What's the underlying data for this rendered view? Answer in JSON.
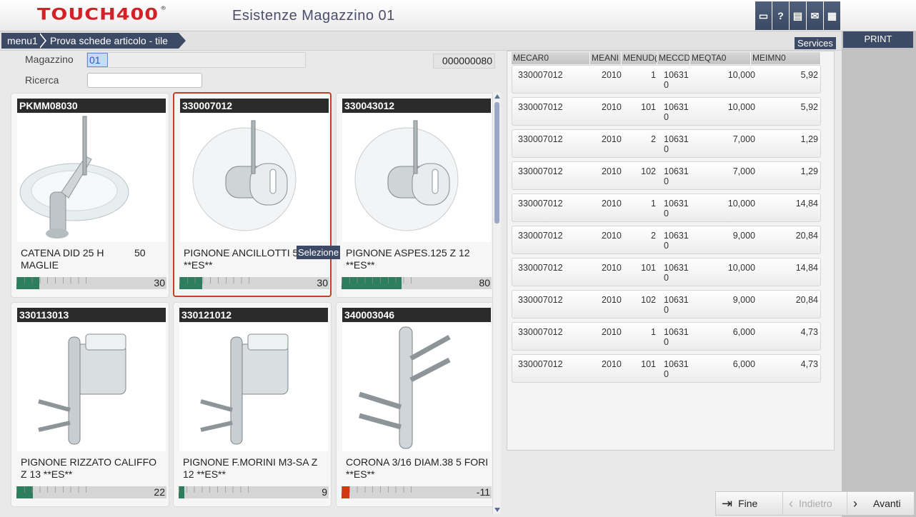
{
  "header": {
    "logo": "TOUCH400",
    "logo_mark": "®",
    "title": "Esistenze Magazzino 01",
    "icons": [
      {
        "name": "monitor-icon",
        "glyph": "▭"
      },
      {
        "name": "help-icon",
        "glyph": "?"
      },
      {
        "name": "document-icon",
        "glyph": "▤"
      },
      {
        "name": "mail-icon",
        "glyph": "✉"
      },
      {
        "name": "grid-icon",
        "glyph": "▦"
      }
    ]
  },
  "breadcrumb": {
    "items": [
      "menu1",
      "Prova schede articolo - tile"
    ]
  },
  "services_label": "Services",
  "print_label": "PRINT",
  "form": {
    "magazzino_label": "Magazzino",
    "magazzino_value": "01",
    "ricerca_label": "Ricerca",
    "ricerca_value": "",
    "counter": "000000080"
  },
  "tooltip": "Selezione",
  "tiles": [
    {
      "code": "PKMM08030",
      "desc": "CATENA DID 25 H MAGLIE",
      "extra": "50",
      "qty": "30",
      "level": 0.15,
      "negative": false
    },
    {
      "code": "330007012",
      "desc": "PIGNONE ANCILLOTTI 50 **ES**",
      "extra": "",
      "qty": "30",
      "level": 0.15,
      "negative": false
    },
    {
      "code": "330043012",
      "desc": "PIGNONE ASPES.125 Z 12 **ES**",
      "extra": "",
      "qty": "80",
      "level": 0.4,
      "negative": false
    },
    {
      "code": "330113013",
      "desc": "PIGNONE RIZZATO CALIFFO Z 13 **ES**",
      "extra": "",
      "qty": "22",
      "level": 0.11,
      "negative": false
    },
    {
      "code": "330121012",
      "desc": "PIGNONE F.MORINI M3-SA Z 12 **ES**",
      "extra": "",
      "qty": "9",
      "level": 0.04,
      "negative": false
    },
    {
      "code": "340003046",
      "desc": "CORONA 3/16 DIAM.38 5 FORI **ES**",
      "extra": "",
      "qty": "-11",
      "level": 0.05,
      "negative": true
    }
  ],
  "grid": {
    "columns": [
      "MECAR0",
      "MEANI",
      "MENUD(",
      "MECCD",
      "MEQTA0",
      "MEIMN0"
    ],
    "rows": [
      {
        "mecar": "330007012",
        "meani": "2010",
        "menud": "1",
        "meccd": "10631\n0",
        "meqta": "10,000",
        "meimn": "5,92"
      },
      {
        "mecar": "330007012",
        "meani": "2010",
        "menud": "101",
        "meccd": "10631\n0",
        "meqta": "10,000",
        "meimn": "5,92"
      },
      {
        "mecar": "330007012",
        "meani": "2010",
        "menud": "2",
        "meccd": "10631\n0",
        "meqta": "7,000",
        "meimn": "1,29"
      },
      {
        "mecar": "330007012",
        "meani": "2010",
        "menud": "102",
        "meccd": "10631\n0",
        "meqta": "7,000",
        "meimn": "1,29"
      },
      {
        "mecar": "330007012",
        "meani": "2010",
        "menud": "1",
        "meccd": "10631\n0",
        "meqta": "10,000",
        "meimn": "14,84"
      },
      {
        "mecar": "330007012",
        "meani": "2010",
        "menud": "2",
        "meccd": "10631\n0",
        "meqta": "9,000",
        "meimn": "20,84"
      },
      {
        "mecar": "330007012",
        "meani": "2010",
        "menud": "101",
        "meccd": "10631\n0",
        "meqta": "10,000",
        "meimn": "14,84"
      },
      {
        "mecar": "330007012",
        "meani": "2010",
        "menud": "102",
        "meccd": "10631\n0",
        "meqta": "9,000",
        "meimn": "20,84"
      },
      {
        "mecar": "330007012",
        "meani": "2010",
        "menud": "1",
        "meccd": "10631\n0",
        "meqta": "6,000",
        "meimn": "4,73"
      },
      {
        "mecar": "330007012",
        "meani": "2010",
        "menud": "101",
        "meccd": "10631\n0",
        "meqta": "6,000",
        "meimn": "4,73"
      }
    ]
  },
  "nav": {
    "fine": "Fine",
    "indietro": "Indietro",
    "avanti": "Avanti"
  },
  "colors": {
    "accent": "#3d4a66",
    "brand": "#d42027",
    "level_ok": "#2e7d5e",
    "level_negative": "#cf3a12",
    "selected_border": "#c9401e"
  }
}
